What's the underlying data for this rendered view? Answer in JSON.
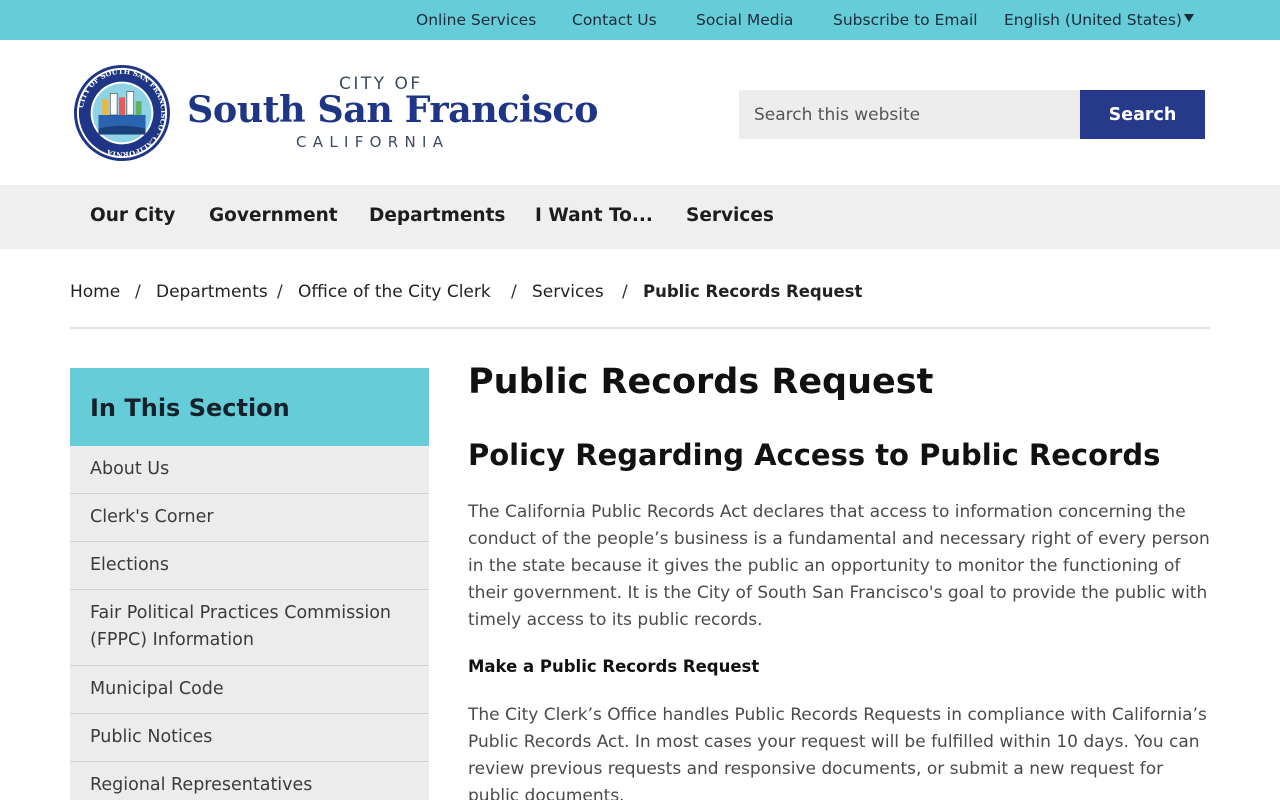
{
  "utility_nav": {
    "items": [
      "Online Services",
      "Contact Us",
      "Social Media",
      "Subscribe to Email"
    ],
    "language": "English (United States)"
  },
  "header": {
    "logo_city_of": "CITY OF",
    "logo_name": "South San Francisco",
    "logo_state": "CALIFORNIA",
    "seal_text": "CITY OF SOUTH SAN FRANCISCO · CALIFORNIA",
    "search_placeholder": "Search this website",
    "search_button": "Search"
  },
  "main_nav": {
    "items": [
      "Our City",
      "Government",
      "Departments",
      "I Want To...",
      "Services"
    ]
  },
  "breadcrumb": {
    "items": [
      "Home",
      "Departments",
      "Office of the City Clerk",
      "Services"
    ],
    "current": "Public Records Request",
    "separator": "/"
  },
  "sidebar": {
    "title": "In This Section",
    "items": [
      "About Us",
      "Clerk's Corner",
      "Elections",
      "Fair Political Practices Commission (FPPC) Information",
      "Municipal Code",
      "Public Notices",
      "Regional Representatives"
    ]
  },
  "content": {
    "page_title": "Public Records Request",
    "section_title": "Policy Regarding Access to Public Records",
    "paragraph_1": "The California Public Records Act declares that access to information concerning the conduct of the people’s business is a fundamental and necessary right of every person in the state because it gives the public an opportunity to monitor the functioning of their government. It is the City of South San Francisco's goal to provide the public with timely access to its public records.",
    "sub_heading": "Make a Public Records Request",
    "paragraph_2": "The City Clerk’s Office handles Public Records Requests in compliance with California’s Public Records Act. In most cases your request will be fulfilled within 10 days. You can review previous requests and responsive documents, or submit a new request for public documents."
  },
  "colors": {
    "accent_teal": "#66cdd8",
    "brand_navy": "#1f3686",
    "button_navy": "#26398a"
  }
}
